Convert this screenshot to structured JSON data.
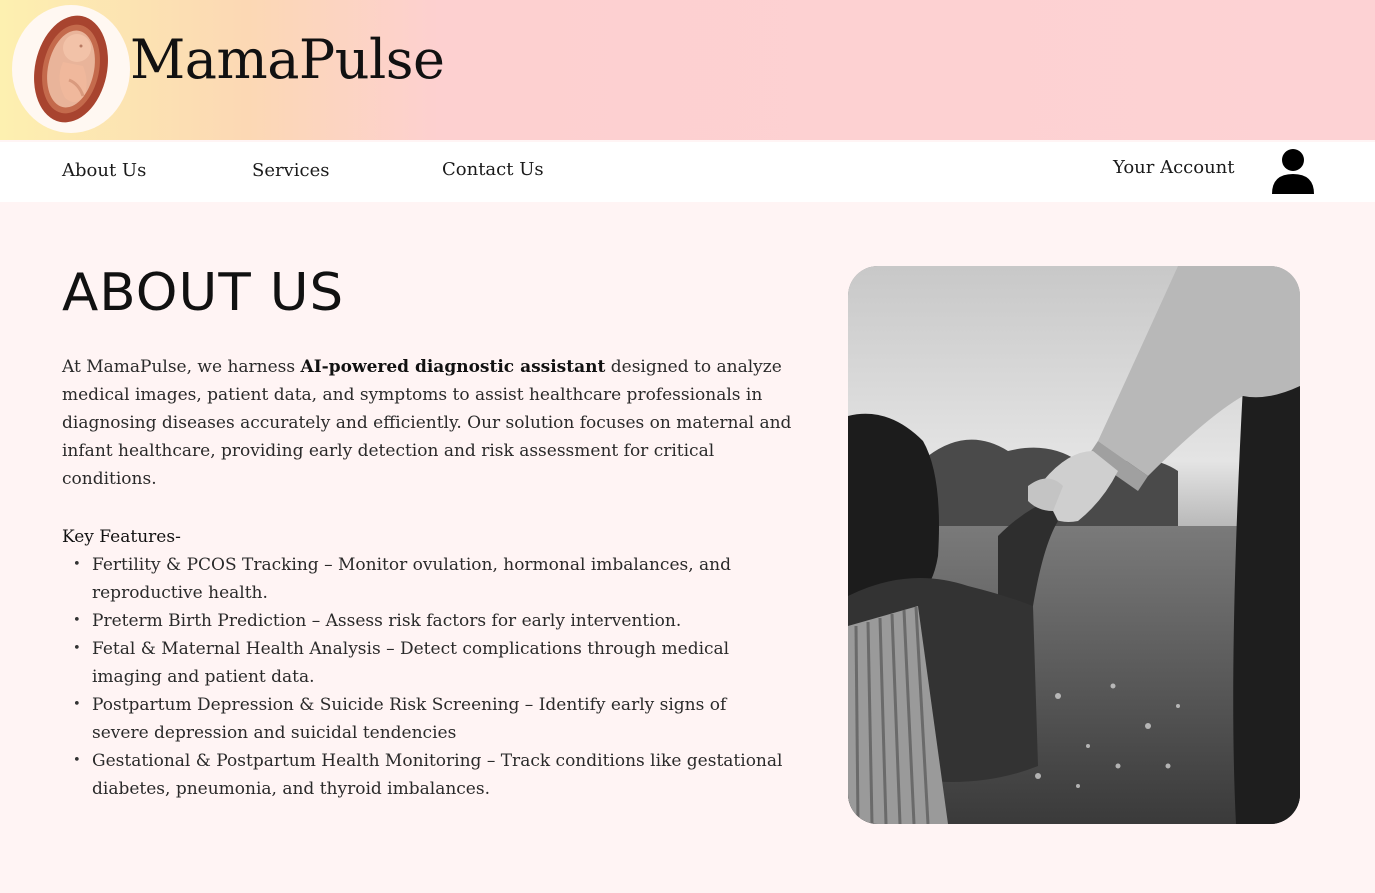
{
  "header": {
    "brand": "MamaPulse",
    "logo_icon": "fetus-logo-icon"
  },
  "nav": {
    "items": [
      {
        "label": "About Us"
      },
      {
        "label": "Services"
      },
      {
        "label": "Contact Us"
      }
    ],
    "account_label": "Your Account",
    "account_icon": "user-icon"
  },
  "main": {
    "title": "ABOUT US",
    "intro_before": "At MamaPulse, we harness ",
    "intro_bold": "AI-powered diagnostic assistant",
    "intro_after": " designed to analyze medical images, patient data, and symptoms to assist healthcare professionals in diagnosing diseases accurately and efficiently. Our solution focuses on maternal and infant healthcare, providing early detection and risk assessment for critical conditions.",
    "features_heading": "Key Features-",
    "features": [
      "Fertility & PCOS Tracking – Monitor ovulation, hormonal imbalances, and reproductive health.",
      "Preterm Birth Prediction – Assess risk factors for early intervention.",
      "Fetal & Maternal Health Analysis – Detect complications through medical imaging and patient data.",
      "Postpartum Depression & Suicide Risk Screening – Identify early signs of severe depression and suicidal tendencies",
      "Gestational & Postpartum Health Monitoring – Track conditions like gestational diabetes, pneumonia, and thyroid imbalances."
    ],
    "photo_icon": "mother-child-photo"
  },
  "colors": {
    "header_gradient_start": "#fdf0b0",
    "header_gradient_end": "#fdd2d4",
    "page_background": "#fff4f4",
    "nav_background": "#ffffff",
    "text": "#1a1a1a"
  }
}
